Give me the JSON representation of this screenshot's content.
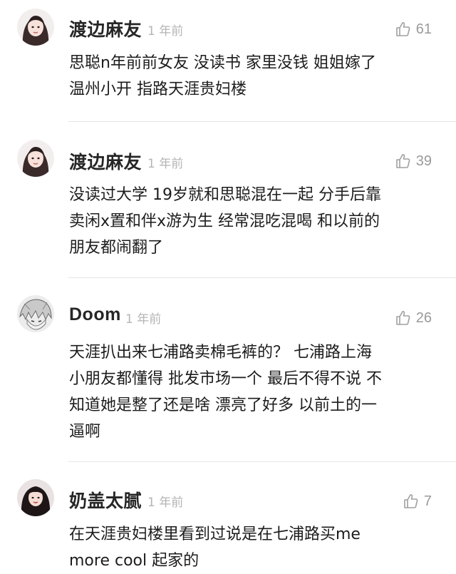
{
  "comments": [
    {
      "username": "渡边麻友",
      "time": "1 年前",
      "likes": "61",
      "avatar_icon": "female-avatar-icon",
      "lines": [
        "思聪n年前前女友 没读书 家里没钱 姐姐嫁了",
        "温州小开 指路天涯贵妇楼"
      ]
    },
    {
      "username": "渡边麻友",
      "time": "1 年前",
      "likes": "39",
      "avatar_icon": "female-avatar-icon",
      "lines": [
        "没读过大学 19岁就和思聪混在一起 分手后靠",
        "卖闲x置和伴x游为生 经常混吃混喝 和以前的",
        "朋友都闹翻了"
      ]
    },
    {
      "username": "Doom",
      "time": "1 年前",
      "likes": "26",
      "avatar_icon": "anime-avatar-icon",
      "lines": [
        "天涯扒出来七浦路卖棉毛裤的？ 七浦路上海",
        "小朋友都懂得 批发市场一个 最后不得不说 不",
        "知道她是整了还是啥 漂亮了好多 以前土的一",
        "逼啊"
      ]
    },
    {
      "username": "奶盖太腻",
      "time": "1 年前",
      "likes": "7",
      "avatar_icon": "female-avatar-icon",
      "lines": [
        "在天涯贵妇楼里看到过说是在七浦路买me",
        "more cool 起家的"
      ]
    }
  ],
  "colors": {
    "username": "#262626",
    "meta": "#b4b4b4",
    "like": "#9a9a9a",
    "divider": "#e6e6e6"
  }
}
